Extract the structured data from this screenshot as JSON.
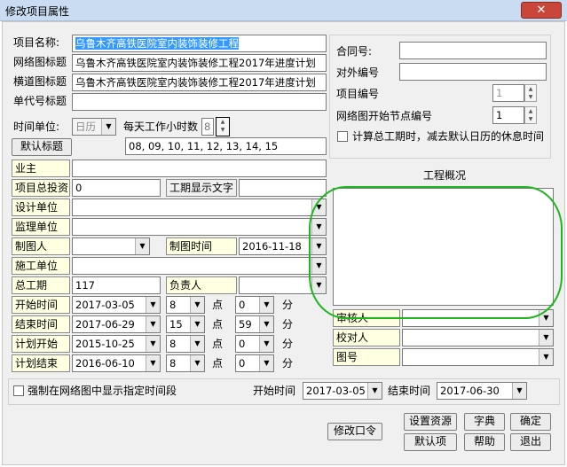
{
  "window": {
    "title": "修改项目属性",
    "close": "✕"
  },
  "left": {
    "project_name_label": "项目名称:",
    "project_name_value": "乌鲁木齐高铁医院室内装饰装修工程",
    "network_title_label": "网络图标题",
    "network_title_value": "乌鲁木齐高铁医院室内装饰装修工程2017年进度计划",
    "bar_title_label": "横道图标题",
    "bar_title_value": "乌鲁木齐高铁医院室内装饰装修工程2017年进度计划",
    "code_title_label": "单代号标题",
    "code_title_value": "",
    "time_unit_label": "时间单位:",
    "time_unit_value": "日历",
    "daily_hours_label": "每天工作小时数",
    "daily_hours_value": "8",
    "default_title_button": "默认标题",
    "work_hours_value": "08, 09, 10, 11, 12, 13, 14, 15"
  },
  "fields": {
    "owner_label": "业主",
    "owner_value": "",
    "investment_label": "项目总投资",
    "investment_value": "0",
    "duration_text_label": "工期显示文字",
    "duration_text_value": "",
    "design_label": "设计单位",
    "supervision_label": "监理单位",
    "drafter_label": "制图人",
    "drawing_time_label": "制图时间",
    "drawing_time_value": "2016-11-18",
    "construction_label": "施工单位",
    "total_duration_label": "总工期",
    "total_duration_value": "117",
    "person_in_charge_label": "负责人",
    "start_time_label": "开始时间",
    "start_date": "2017-03-05",
    "start_hour": "8",
    "start_minute": "0",
    "end_time_label": "结束时间",
    "end_date": "2017-06-29",
    "end_hour": "15",
    "end_minute": "59",
    "plan_start_label": "计划开始",
    "plan_start_date": "2015-10-25",
    "plan_start_hour": "8",
    "plan_start_minute": "0",
    "plan_end_label": "计划结束",
    "plan_end_date": "2016-06-10",
    "plan_end_hour": "8",
    "plan_end_minute": "0",
    "hour_unit": "点",
    "minute_unit": "分"
  },
  "right": {
    "contract_label": "合同号:",
    "external_code_label": "对外编号",
    "project_code_label": "项目编号",
    "project_code_value": "1",
    "start_node_label": "网络图开始节点编号",
    "start_node_value": "1",
    "calc_checkbox_label": "计算总工期时，减去默认日历的休息时间",
    "overview_title": "工程概况",
    "reviewer_label": "审核人",
    "proofreader_label": "校对人",
    "drawing_no_label": "图号"
  },
  "bottom": {
    "force_label": "强制在网络图中显示指定时间段",
    "start_time_label": "开始时间",
    "start_time_value": "2017-03-05",
    "end_time_label": "结束时间",
    "end_time_value": "2017-06-30",
    "change_password": "修改口令",
    "set_resources": "设置资源",
    "dictionary": "字典",
    "ok": "确定",
    "default_item": "默认项",
    "help": "帮助",
    "exit": "退出"
  }
}
